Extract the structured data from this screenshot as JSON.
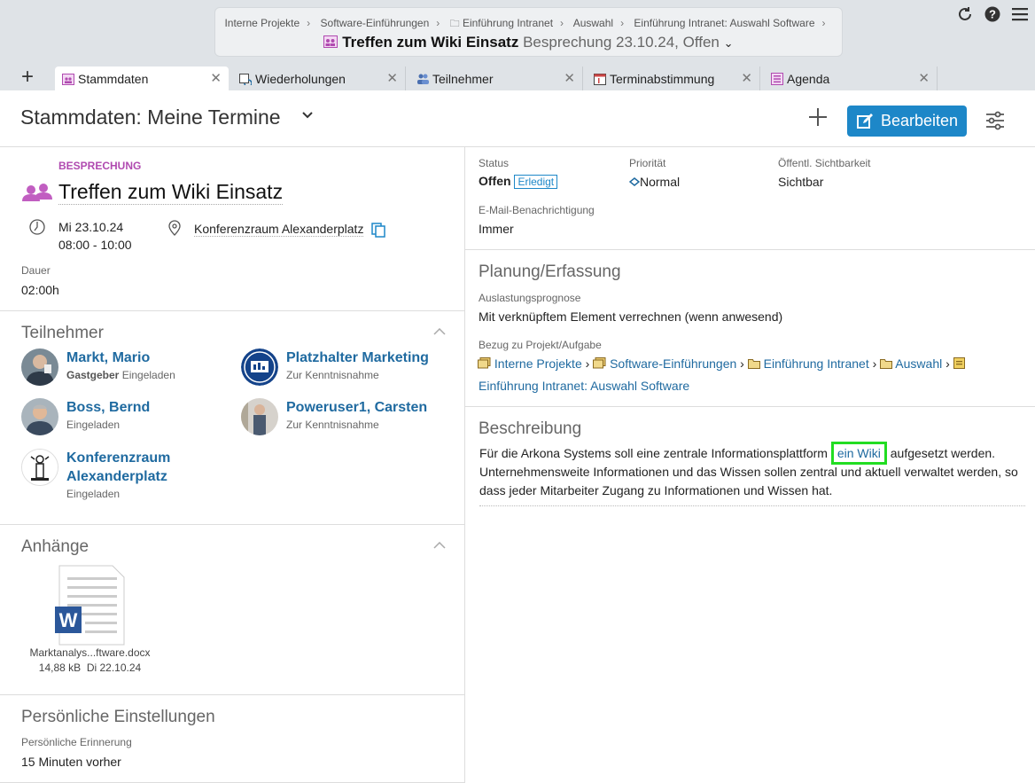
{
  "breadcrumb": {
    "items": [
      "Interne Projekte",
      "Software-Einführungen",
      "Einführung Intranet",
      "Auswahl",
      "Einführung Intranet: Auswahl Software"
    ],
    "title": "Treffen zum Wiki Einsatz",
    "subtitle": "Besprechung 23.10.24, Offen"
  },
  "tabs": [
    {
      "label": "Stammdaten",
      "icon": "calendar-icon",
      "active": true
    },
    {
      "label": "Wiederholungen",
      "icon": "repeat-icon",
      "active": false
    },
    {
      "label": "Teilnehmer",
      "icon": "people-icon",
      "active": false
    },
    {
      "label": "Terminabstimmung",
      "icon": "calendar-check-icon",
      "active": false
    },
    {
      "label": "Agenda",
      "icon": "list-icon",
      "active": false
    }
  ],
  "header": {
    "title": "Stammdaten: Meine Termine",
    "edit_label": "Bearbeiten"
  },
  "meeting": {
    "type": "BESPRECHUNG",
    "title": "Treffen zum Wiki Einsatz",
    "date": "Mi 23.10.24",
    "time": "08:00 - 10:00",
    "location": "Konferenzraum Alexanderplatz",
    "duration_label": "Dauer",
    "duration": "02:00h"
  },
  "participants": {
    "title": "Teilnehmer",
    "items": [
      {
        "name": "Markt, Mario",
        "role": "Gastgeber",
        "status": "Eingeladen"
      },
      {
        "name": "Platzhalter Marketing",
        "role": "",
        "status": "Zur Kenntnisnahme"
      },
      {
        "name": "Boss, Bernd",
        "role": "",
        "status": "Eingeladen"
      },
      {
        "name": "Poweruser1, Carsten",
        "role": "",
        "status": "Zur Kenntnisnahme"
      },
      {
        "name": "Konferenzraum Alexanderplatz",
        "role": "",
        "status": "Eingeladen"
      }
    ]
  },
  "attachments": {
    "title": "Anhänge",
    "file": {
      "name": "Marktanalys...ftware.docx",
      "size": "14,88 kB",
      "date": "Di 22.10.24"
    }
  },
  "personal": {
    "title": "Persönliche Einstellungen",
    "reminder_label": "Persönliche Erinnerung",
    "reminder_value": "15 Minuten vorher"
  },
  "status": {
    "status_label": "Status",
    "status_value": "Offen",
    "status_badge": "Erledigt",
    "priority_label": "Priorität",
    "priority_value": "Normal",
    "visibility_label": "Öffentl. Sichtbarkeit",
    "visibility_value": "Sichtbar",
    "email_label": "E-Mail-Benachrichtigung",
    "email_value": "Immer"
  },
  "planning": {
    "title": "Planung/Erfassung",
    "forecast_label": "Auslastungsprognose",
    "forecast_value": "Mit verknüpftem Element verrechnen (wenn anwesend)",
    "relation_label": "Bezug zu Projekt/Aufgabe",
    "relation_items": [
      "Interne Projekte",
      "Software-Einführungen",
      "Einführung Intranet",
      "Auswahl"
    ],
    "relation_last": "Einführung Intranet: Auswahl Software"
  },
  "description": {
    "title": "Beschreibung",
    "text_before": "Für die Arkona Systems soll eine zentrale Informationsplattform ",
    "link": "ein Wiki",
    "text_after": " aufgesetzt werden. Unternehmensweite Informationen und das Wissen sollen zentral und aktuell verwaltet werden, so dass jeder Mitarbeiter Zugang zu Informationen und Wissen hat."
  }
}
